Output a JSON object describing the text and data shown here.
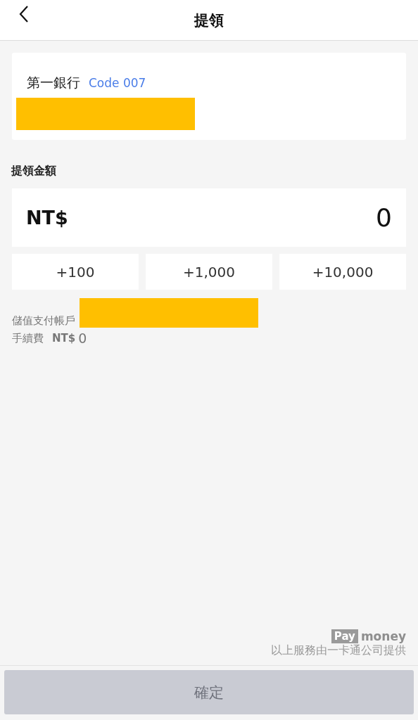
{
  "header": {
    "title": "提領"
  },
  "bank": {
    "name": "第一銀行",
    "code": "Code 007"
  },
  "amount": {
    "label": "提領金額",
    "currency": "NT$",
    "value": "0"
  },
  "quick_add": [
    "+100",
    "+1,000",
    "+10,000"
  ],
  "info": {
    "account_label": "儲值支付帳戶",
    "fee_label": "手續費",
    "fee_currency": "NT$",
    "fee_value": "0"
  },
  "footer": {
    "logo_left": "Pay",
    "logo_right": "money",
    "note": "以上服務由一卡通公司提供"
  },
  "confirm": {
    "label": "確定",
    "disabled": true
  }
}
